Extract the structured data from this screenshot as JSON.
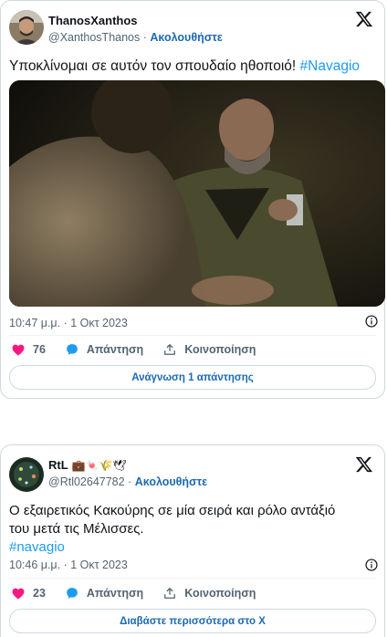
{
  "tweet1": {
    "display_name": "ThanosXanthos",
    "handle": "@XanthosThanos",
    "separator": "·",
    "follow_label": "Ακολουθήστε",
    "text": "Υποκλίνομαι σε αυτόν τον σπουδαίο ηθοποιό!",
    "hashtag": "#Navagio",
    "timestamp": "10:47 μ.μ. · 1 Οκτ 2023",
    "like_count": "76",
    "reply_label": "Απάντηση",
    "share_label": "Κοινοποίηση",
    "read_replies_label": "Ανάγνωση 1 απάντησης"
  },
  "tweet2": {
    "display_name": "RtL",
    "name_emojis": "💼🍬🌾🕊",
    "handle": "@Rtl02647782",
    "separator": "·",
    "follow_label": "Ακολουθήστε",
    "text_line1": "Ο εξαιρετικός Κακούρης σε μία σειρά και ρόλο αντάξιό",
    "text_line2": "του μετά τις Μέλισσες.",
    "hashtag": "#navagio",
    "timestamp": "10:46 μ.μ. · 1 Οκτ 2023",
    "like_count": "23",
    "reply_label": "Απάντηση",
    "share_label": "Κοινοποίηση",
    "read_more_label": "Διαβάστε περισσότερα στο X"
  },
  "icons": {
    "logo": "x-logo-icon",
    "info": "info-icon",
    "like": "heart-icon",
    "reply": "speech-bubble-icon",
    "share": "share-arrow-icon"
  },
  "colors": {
    "heart": "#f91880",
    "reply": "#1d9bf0",
    "link": "#1d6ab0",
    "hashtag": "#1d9bf0",
    "border": "#cfd9de",
    "secondary_text": "#536471"
  }
}
